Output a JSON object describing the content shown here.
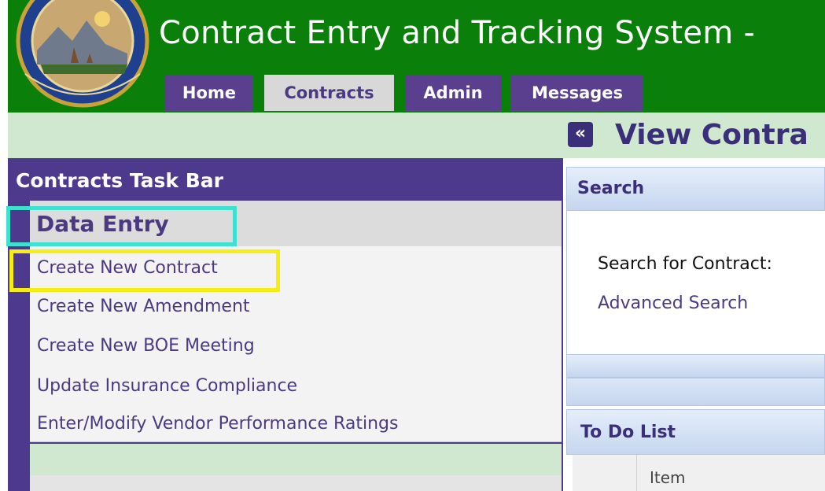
{
  "app": {
    "title": "Contract Entry and Tracking System -"
  },
  "nav": {
    "tabs": [
      {
        "label": "Home",
        "active": false
      },
      {
        "label": "Contracts",
        "active": true
      },
      {
        "label": "Admin",
        "active": false
      },
      {
        "label": "Messages",
        "active": false
      }
    ]
  },
  "view": {
    "title": "View Contra",
    "collapse_icon": "double-chevron-left-icon"
  },
  "sidebar": {
    "title": "Contracts Task Bar",
    "section": "Data Entry",
    "items": [
      "Create New Contract",
      "Create New Amendment",
      "Create New BOE Meeting",
      "Update Insurance Compliance",
      "Enter/Modify Vendor Performance Ratings"
    ]
  },
  "search": {
    "title": "Search",
    "label": "Search for Contract:",
    "advanced_link": "Advanced Search"
  },
  "todo": {
    "title": "To Do List",
    "columns": [
      "Item"
    ]
  },
  "colors": {
    "header_green": "#0a800a",
    "tab_purple": "#5b3f8f",
    "sidebar_purple": "#4e3a8c",
    "highlight_cyan": "#3ee0cf",
    "highlight_yellow": "#f5ee10"
  }
}
